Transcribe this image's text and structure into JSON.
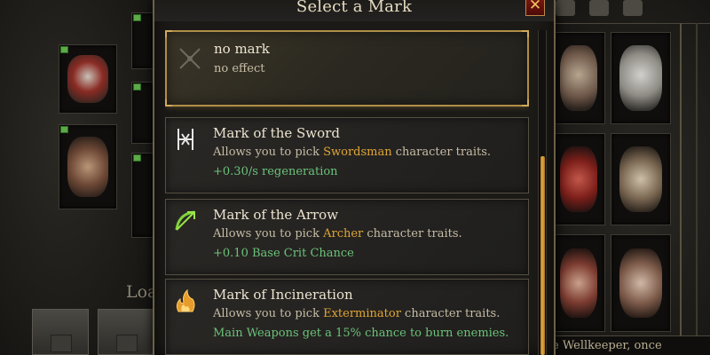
{
  "modal": {
    "title": "Select a Mark",
    "close_label": "✕",
    "entries": [
      {
        "name": "no mark",
        "desc_plain": "no effect",
        "icon": "crossed-out-icon",
        "selected": true
      },
      {
        "name": "Mark of the Sword",
        "desc_pre": "Allows you to pick ",
        "desc_highlight": "Swordsman",
        "desc_post": " character traits.",
        "bonus": "+0.30/s regeneration",
        "icon": "sword-mark-icon"
      },
      {
        "name": "Mark of the Arrow",
        "desc_pre": "Allows you to pick ",
        "desc_highlight": "Archer",
        "desc_post": " character traits.",
        "bonus": "+0.10 Base Crit Chance",
        "icon": "bow-mark-icon"
      },
      {
        "name": "Mark of Incineration",
        "desc_pre": "Allows you to pick ",
        "desc_highlight": "Exterminator",
        "desc_post": " character traits.",
        "bonus": "Main Weapons get a 15% chance to burn enemies.",
        "icon": "flame-mark-icon"
      }
    ]
  },
  "background": {
    "loadout_label": "Loa",
    "footer_text": "e Wellkeeper, once"
  },
  "colors": {
    "highlight": "#e0a535",
    "bonus": "#6cc27a",
    "accent_gold": "#b08e47",
    "close_red": "#7c1812"
  }
}
